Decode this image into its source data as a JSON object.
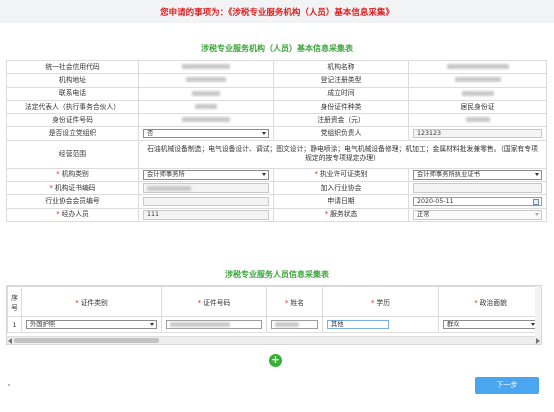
{
  "header": {
    "title": "您申请的事项为：《涉税专业服务机构（人员）基本信息采集》"
  },
  "org_section": {
    "title": "涉税专业服务机构（人员）基本信息采集表"
  },
  "org_rows": {
    "r1": {
      "l1": "统一社会信用代码",
      "l2": "机构名称"
    },
    "r2": {
      "l1": "机构地址",
      "l2": "登记注册类型"
    },
    "r3": {
      "l1": "联系电话",
      "l2": "成立时间"
    },
    "r4": {
      "l1": "法定代表人（执行事务合伙人）",
      "l2": "身份证件种类",
      "v2": "居民身份证"
    },
    "r5": {
      "l1": "身份证件号码",
      "l2": "注册资金（元）"
    },
    "r6": {
      "l1": "是否设立党组织",
      "v1": "否",
      "l2": "党组织负责人",
      "v2": "123123"
    },
    "r7": {
      "l1": "经营范围",
      "v1": "石油机械设备制造；电气设备设计、调试；图文设计；静电喷涂；电气机械设备修理；机加工；金属材料批发兼零售。（国家有专项规定的按专项规定办理）"
    },
    "r8": {
      "l1": "机构类别",
      "v1": "会计师事务所",
      "l2": "执业许可证类别",
      "v2": "会计师事务所执业证书"
    },
    "r9": {
      "l1": "机构证书编码",
      "l2": "加入行业协会"
    },
    "r10": {
      "l1": "行业协会会员编号",
      "l2": "申请日期",
      "v2": "2020-05-11"
    },
    "r11": {
      "l1": "经办人员",
      "v1": "111",
      "l2": "服务状态",
      "v2": "正常"
    }
  },
  "staff_section": {
    "title": "涉税专业服务人员信息采集表"
  },
  "staff_table": {
    "headers": {
      "seq": "序号",
      "doc_type": "证件类别",
      "doc_no": "证件号码",
      "name": "姓名",
      "education": "学历",
      "politics": "政治面貌"
    },
    "row1": {
      "seq": "1",
      "doc_type": "外国护照",
      "education": "其他",
      "politics": "群众"
    }
  },
  "actions": {
    "add": "+",
    "next": "下一步"
  },
  "colors": {
    "title_red": "#e02020",
    "section_green": "#3aa53a",
    "button_blue": "#4aa6ee"
  }
}
